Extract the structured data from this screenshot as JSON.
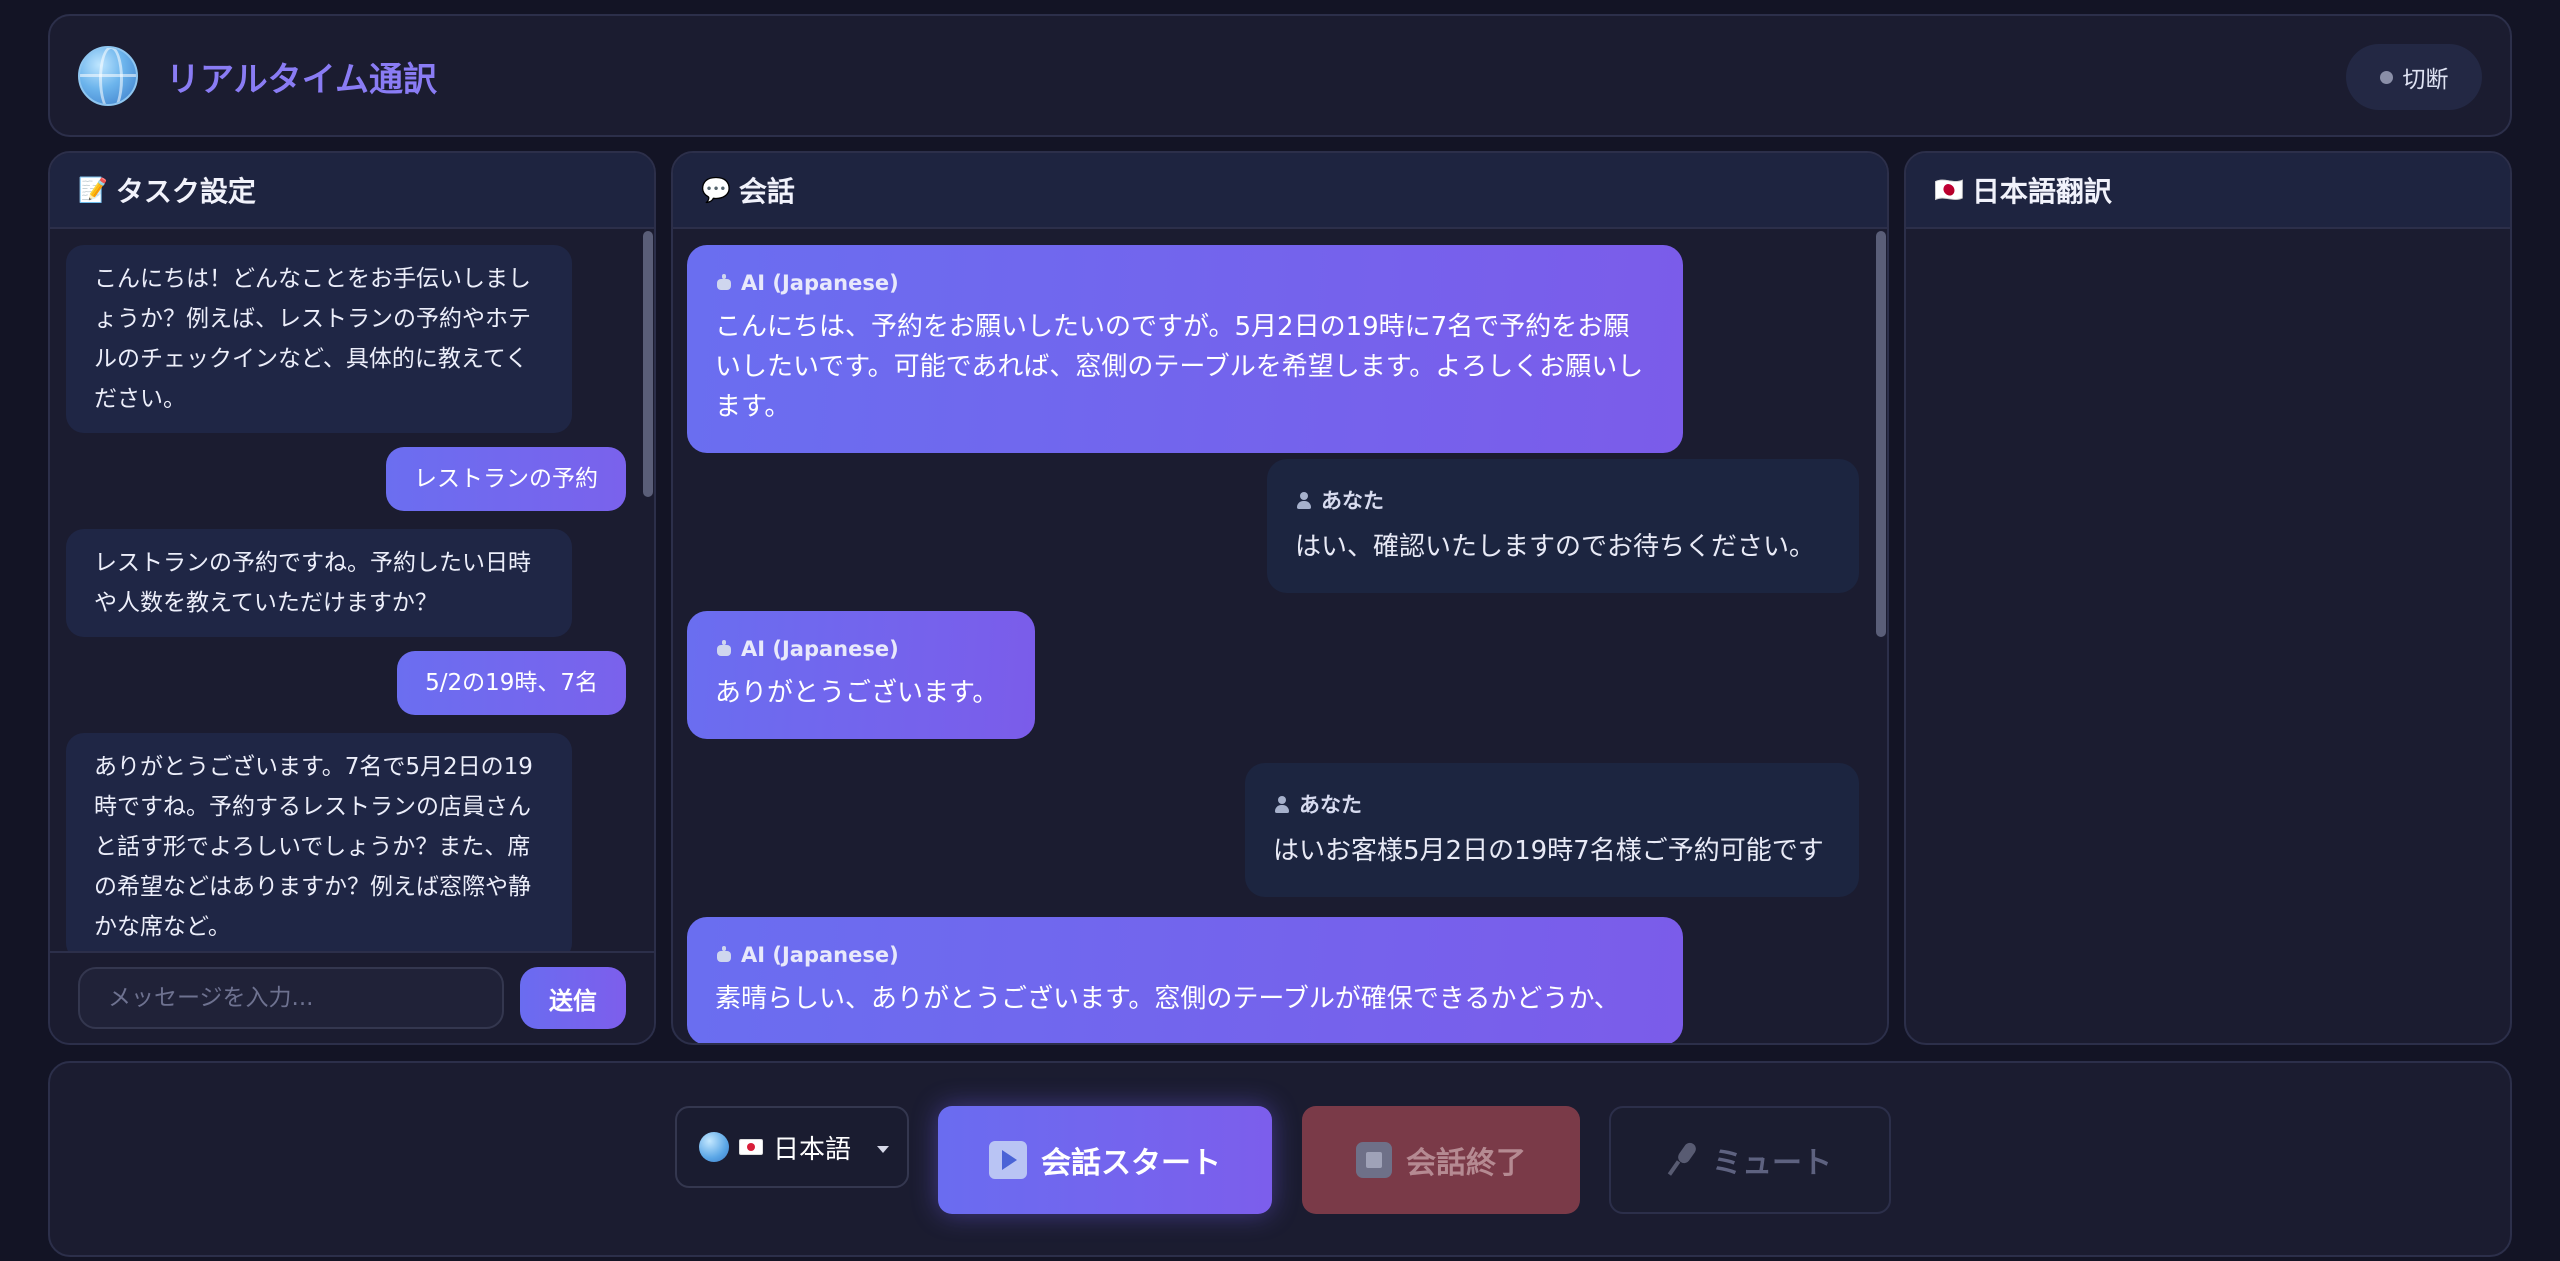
{
  "header": {
    "icon": "globe-icon",
    "title": "リアルタイム通訳",
    "status": "切断",
    "status_color": "#8a8fa8",
    "accent_color": "#8a7cf4"
  },
  "task_panel": {
    "icon": "memo-icon",
    "title": "タスク設定",
    "messages": [
      {
        "role": "bot",
        "text": "こんにちは！どんなことをお手伝いしましょうか？例えば、レストランの予約やホテルのチェックインなど、具体的に教えてください。"
      },
      {
        "role": "user",
        "text": "レストランの予約"
      },
      {
        "role": "bot",
        "text": "レストランの予約ですね。予約したい日時や人数を教えていただけますか？"
      },
      {
        "role": "user",
        "text": "5/2の19時、7名"
      },
      {
        "role": "bot",
        "text": "ありがとうございます。7名で5月2日の19時ですね。予約するレストランの店員さんと話す形でよろしいでしょうか？また、席の希望などはありますか？例えば窓際や静かな席など。"
      }
    ],
    "input_placeholder": "メッセージを入力...",
    "send_label": "送信"
  },
  "conversation_panel": {
    "icon": "speech-bubble-icon",
    "title": "会話",
    "messages": [
      {
        "role": "ai",
        "label": "AI (Japanese)",
        "text": "こんにちは、予約をお願いしたいのですが。5月2日の19時に7名で予約をお願いしたいです。可能であれば、窓側のテーブルを希望します。よろしくお願いします。"
      },
      {
        "role": "user",
        "label": "あなた",
        "text": "はい、確認いたしますのでお待ちください。"
      },
      {
        "role": "ai",
        "label": "AI (Japanese)",
        "text": "ありがとうございます。"
      },
      {
        "role": "user",
        "label": "あなた",
        "text": "はいお客様5月2日の19時7名様ご予約可能です"
      },
      {
        "role": "ai",
        "label": "AI (Japanese)",
        "text": "素晴らしい、ありがとうございます。窓側のテーブルが確保できるかどうか、"
      }
    ]
  },
  "translation_panel": {
    "icon": "japan-flag-icon",
    "title": "日本語翻訳"
  },
  "controls": {
    "language": "日本語",
    "start_label": "会話スタート",
    "end_label": "会話終了",
    "mute_label": "ミュート"
  }
}
